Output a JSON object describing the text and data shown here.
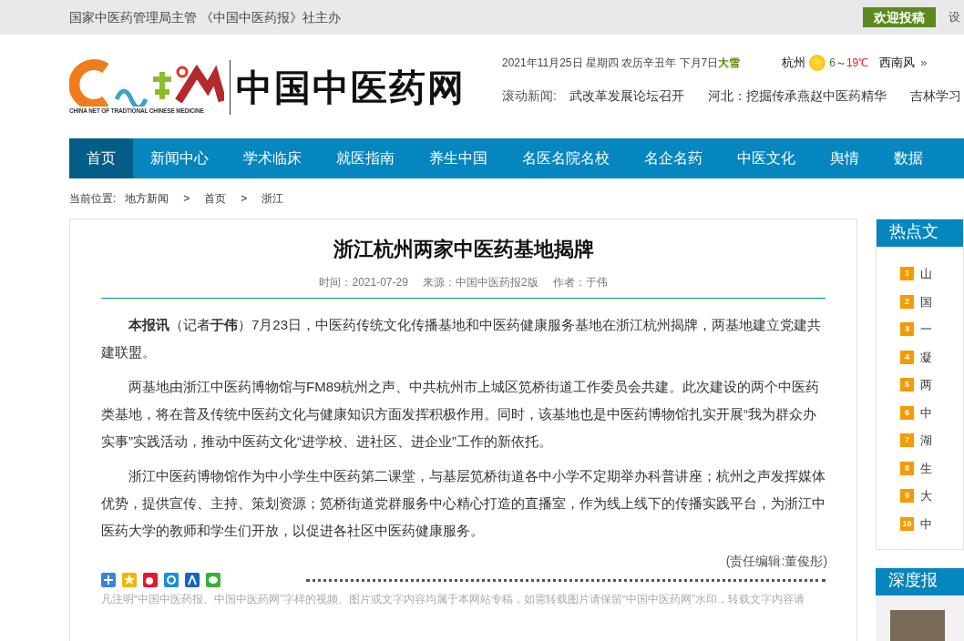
{
  "topbar": {
    "sponsor": "国家中医药管理局主管 《中国中医药报》社主办",
    "submit_button": "欢迎投稿",
    "side_link": "设"
  },
  "logo": {
    "name": "中国中医药网",
    "subtitle": "CHINA NET OF TRADTIONAL CHINESE MEDICINE"
  },
  "date_line": {
    "date": "2021年11月25日 星期四 农历辛丑年 下月7日",
    "solar_term": "大雪"
  },
  "weather": {
    "city": "杭州",
    "low": "6",
    "sep": "～",
    "high": "19℃",
    "wind": "西南风",
    "more": "»"
  },
  "ticker": {
    "label": "滚动新闻:",
    "items": [
      "武改革发展论坛召开",
      "河北：挖掘传承燕赵中医药精华",
      "吉林学习"
    ]
  },
  "nav": [
    {
      "label": "首页",
      "selected": true
    },
    {
      "label": "新闻中心",
      "selected": false
    },
    {
      "label": "学术临床",
      "selected": false
    },
    {
      "label": "就医指南",
      "selected": false
    },
    {
      "label": "养生中国",
      "selected": false
    },
    {
      "label": "名医名院名校",
      "selected": false
    },
    {
      "label": "名企名药",
      "selected": false
    },
    {
      "label": "中医文化",
      "selected": false
    },
    {
      "label": "舆情",
      "selected": false
    },
    {
      "label": "数据",
      "selected": false
    }
  ],
  "breadcrumb": {
    "label": "当前位置:",
    "items": [
      "地方新闻",
      "首页",
      "浙江"
    ],
    "separator": ">"
  },
  "article": {
    "title": "浙江杭州两家中医药基地揭牌",
    "meta": [
      "时间：2021-07-29",
      "来源：中国中医药报2版",
      "作者：于伟"
    ],
    "paragraphs": [
      "**本报讯**（记者**于伟**）7月23日，中医药传统文化传播基地和中医药健康服务基地在浙江杭州揭牌，两基地建立党建共建联盟。",
      "两基地由浙江中医药博物馆与FM89杭州之声、中共杭州市上城区笕桥街道工作委员会共建。此次建设的两个中医药类基地，将在普及传统中医药文化与健康知识方面发挥积极作用。同时，该基地也是中医药博物馆扎实开展“我为群众办实事”实践活动，推动中医药文化“进学校、进社区、进企业”工作的新依托。",
      "浙江中医药博物馆作为中小学生中医药第二课堂，与基层笕桥街道各中小学不定期举办科普讲座；杭州之声发挥媒体优势，提供宣传、主持、策划资源；笕桥街道党群服务中心精心打造的直播室，作为线上线下的传播实践平台，为浙江中医药大学的教师和学生们开放，以促进各社区中医药健康服务。"
    ],
    "editor": "(责任编辑:董俊彤)",
    "notice": "凡注明“中国中医药报、中国中医药网”字样的视频、图片或文字内容均属于本网站专稿，如需转载图片请保留“中国中医药网”水印，转载文字内容请"
  },
  "share_icons": [
    {
      "kind": "plus"
    },
    {
      "kind": "qzone"
    },
    {
      "kind": "weibo"
    },
    {
      "kind": "p"
    },
    {
      "kind": "renren"
    },
    {
      "kind": "wechat"
    }
  ],
  "hot": {
    "title": "热点文",
    "items": [
      "山",
      "国",
      "一",
      "凝",
      "两",
      "中",
      "湖",
      "生",
      "大",
      "中"
    ],
    "numbers": [
      "1",
      "2",
      "3",
      "4",
      "5",
      "6",
      "7",
      "8",
      "9",
      "10"
    ]
  },
  "depth": {
    "title": "深度报"
  }
}
